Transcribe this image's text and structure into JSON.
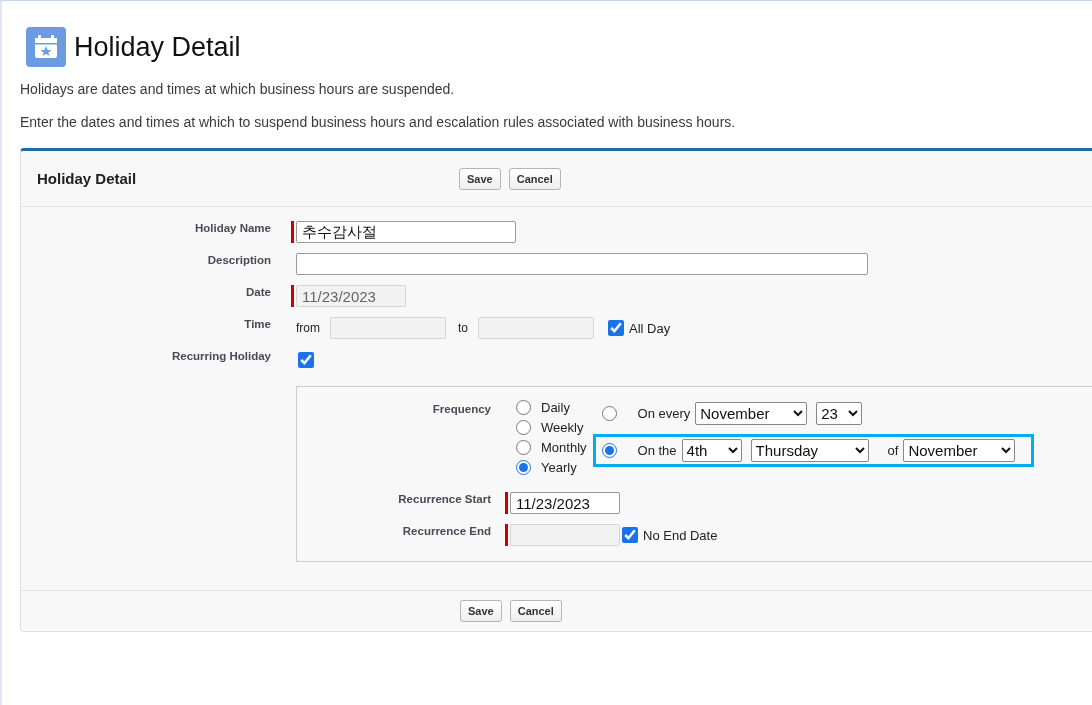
{
  "page": {
    "title": "Holiday Detail",
    "descriptions": [
      "Holidays are dates and times at which business hours are suspended.",
      "Enter the dates and times at which to suspend business hours and escalation rules associated with business hours."
    ]
  },
  "panel": {
    "title": "Holiday Detail",
    "buttons": [
      "Save",
      "Cancel"
    ],
    "footer_buttons": [
      "Save",
      "Cancel"
    ]
  },
  "holiday_name": {
    "label": "Holiday Name",
    "value": "추수감사절",
    "required": true
  },
  "description": {
    "label": "Description"
  },
  "date": {
    "label": "Date",
    "value": "11/23/2023",
    "required": true,
    "disabled": true
  },
  "time": {
    "label": "Time",
    "from_label": "from",
    "to_label": "to",
    "all_day": {
      "label": "All Day",
      "checked": true
    }
  },
  "recurring": {
    "label": "Recurring Holiday",
    "checked": true
  },
  "recurrence": {
    "frequency_label": "Frequency",
    "frequencies": [
      {
        "label": "Daily",
        "selected": false
      },
      {
        "label": "Weekly",
        "selected": false
      },
      {
        "label": "Monthly",
        "selected": false
      },
      {
        "label": "Yearly",
        "selected": true
      }
    ],
    "options": [
      {
        "kind": "every",
        "selected": false,
        "highlighted": false,
        "prefix": "On every",
        "month": "November",
        "day": "23"
      },
      {
        "kind": "nth",
        "selected": true,
        "highlighted": true,
        "prefix": "On the",
        "ordinal": "4th",
        "weekday": "Thursday",
        "of": "of",
        "month": "November"
      }
    ],
    "start": {
      "label": "Recurrence Start",
      "value": "11/23/2023",
      "required": true
    },
    "end": {
      "label": "Recurrence End",
      "required": true,
      "no_end_date": {
        "label": "No End Date",
        "checked": true
      }
    }
  }
}
